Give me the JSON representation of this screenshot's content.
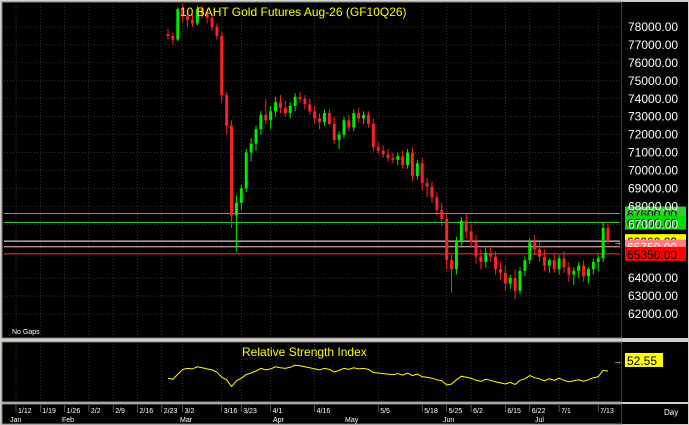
{
  "chart_data": {
    "type": "candlestick",
    "title": "10 BAHT  Gold  Futures  Aug-26  (GF10Q26)",
    "ylim": [
      61000,
      79500
    ],
    "yticks": [
      "78000.00",
      "77000.00",
      "76000.00",
      "75000.00",
      "74000.00",
      "73000.00",
      "72000.00",
      "71000.00",
      "70000.00",
      "69000.00",
      "68000.00",
      "67000.00",
      "64000.00",
      "63000.00",
      "62000.00"
    ],
    "note": "No Gaps",
    "levels": [
      {
        "label": "67600.00",
        "value": 67600,
        "color": "#33cc33",
        "bg": "#33cc33",
        "fg": "#000000"
      },
      {
        "label": "67100.00",
        "value": 67100,
        "color": "#33cc33",
        "bg": "#00dd00",
        "fg": "#000000"
      },
      {
        "label": "66060.00",
        "value": 66060,
        "color": "#ffffff",
        "bg": "#ffff00",
        "fg": "#000000"
      },
      {
        "label": "65750.00",
        "value": 65750,
        "color": "#ffbbbb",
        "bg": "#ff8080",
        "fg": "#ffffff"
      },
      {
        "label": "65350.00",
        "value": 65350,
        "color": "#ff3333",
        "bg": "#ff0000",
        "fg": "#000000"
      }
    ],
    "candles": [
      [
        77600,
        77900,
        77300,
        77500
      ],
      [
        77500,
        77700,
        77000,
        77300
      ],
      [
        77300,
        79100,
        77200,
        79000
      ],
      [
        79000,
        79300,
        78300,
        78600
      ],
      [
        78600,
        78900,
        78000,
        78400
      ],
      [
        78400,
        78700,
        78000,
        78200
      ],
      [
        78200,
        79200,
        78100,
        79000
      ],
      [
        79000,
        79200,
        78500,
        78700
      ],
      [
        78700,
        79000,
        78200,
        78500
      ],
      [
        78500,
        78700,
        77800,
        78000
      ],
      [
        78000,
        78200,
        77300,
        77500
      ],
      [
        77500,
        77700,
        73800,
        74200
      ],
      [
        74200,
        74400,
        72000,
        72500
      ],
      [
        72500,
        72800,
        66800,
        67500
      ],
      [
        67500,
        68600,
        65500,
        68200
      ],
      [
        68200,
        69200,
        67800,
        69000
      ],
      [
        69000,
        71200,
        68800,
        71000
      ],
      [
        71000,
        71800,
        70500,
        71500
      ],
      [
        71500,
        72500,
        71100,
        72300
      ],
      [
        72300,
        73300,
        72000,
        73100
      ],
      [
        73100,
        74000,
        72600,
        72800
      ],
      [
        72800,
        73600,
        72300,
        73300
      ],
      [
        73300,
        74100,
        73000,
        73800
      ],
      [
        73800,
        74200,
        73200,
        73500
      ],
      [
        73500,
        73900,
        73000,
        73200
      ],
      [
        73200,
        73800,
        72900,
        73600
      ],
      [
        73600,
        74300,
        73300,
        74100
      ],
      [
        74100,
        74400,
        73800,
        74000
      ],
      [
        74000,
        74200,
        73400,
        73700
      ],
      [
        73700,
        74000,
        73100,
        73300
      ],
      [
        73300,
        73600,
        72600,
        72900
      ],
      [
        72900,
        73200,
        72300,
        72700
      ],
      [
        72700,
        73400,
        72500,
        73200
      ],
      [
        73200,
        73400,
        72500,
        72600
      ],
      [
        72600,
        73000,
        71500,
        71700
      ],
      [
        71700,
        72200,
        71200,
        72000
      ],
      [
        72000,
        73000,
        71800,
        72800
      ],
      [
        72800,
        73100,
        72200,
        72400
      ],
      [
        72400,
        73400,
        72200,
        73200
      ],
      [
        73200,
        73500,
        72700,
        72900
      ],
      [
        72900,
        73300,
        72600,
        73100
      ],
      [
        73100,
        73300,
        72400,
        72600
      ],
      [
        72600,
        72900,
        71100,
        71300
      ],
      [
        71300,
        71600,
        70900,
        71100
      ],
      [
        71100,
        71400,
        70700,
        70900
      ],
      [
        70900,
        71200,
        70500,
        70700
      ],
      [
        70700,
        71000,
        70400,
        70600
      ],
      [
        70600,
        71000,
        70300,
        70800
      ],
      [
        70800,
        71100,
        70100,
        70300
      ],
      [
        70300,
        71200,
        70100,
        71000
      ],
      [
        71000,
        71300,
        69400,
        69700
      ],
      [
        69700,
        70600,
        69500,
        70400
      ],
      [
        70400,
        70700,
        68900,
        69300
      ],
      [
        69300,
        69600,
        68500,
        69100
      ],
      [
        69100,
        69400,
        68200,
        68500
      ],
      [
        68500,
        68800,
        67500,
        67800
      ],
      [
        67800,
        68200,
        66900,
        67300
      ],
      [
        67300,
        67600,
        64500,
        65000
      ],
      [
        65000,
        65300,
        63200,
        64500
      ],
      [
        64500,
        66300,
        64200,
        66000
      ],
      [
        66000,
        67400,
        65700,
        67200
      ],
      [
        67200,
        67600,
        66200,
        66600
      ],
      [
        66600,
        67000,
        65700,
        66000
      ],
      [
        66000,
        66400,
        64800,
        65200
      ],
      [
        65200,
        65600,
        64500,
        64900
      ],
      [
        64900,
        65700,
        64600,
        65400
      ],
      [
        65400,
        65800,
        64900,
        65200
      ],
      [
        65200,
        65500,
        64200,
        64500
      ],
      [
        64500,
        64900,
        63900,
        64300
      ],
      [
        64300,
        64700,
        63300,
        63700
      ],
      [
        63700,
        64200,
        63400,
        64000
      ],
      [
        64000,
        64500,
        62800,
        63300
      ],
      [
        63300,
        64600,
        63100,
        64400
      ],
      [
        64400,
        65200,
        64100,
        65000
      ],
      [
        65000,
        66200,
        64800,
        66000
      ],
      [
        66000,
        66400,
        65300,
        65600
      ],
      [
        65600,
        66000,
        64900,
        65200
      ],
      [
        65200,
        65600,
        64400,
        64700
      ],
      [
        64700,
        65100,
        64300,
        65000
      ],
      [
        65000,
        65400,
        64300,
        64500
      ],
      [
        64500,
        65300,
        64200,
        65100
      ],
      [
        65100,
        65500,
        64300,
        64600
      ],
      [
        64600,
        64900,
        63800,
        64200
      ],
      [
        64200,
        64600,
        63600,
        64400
      ],
      [
        64400,
        64900,
        64000,
        64700
      ],
      [
        64700,
        65000,
        63800,
        64100
      ],
      [
        64100,
        64600,
        63700,
        64500
      ],
      [
        64500,
        65100,
        64200,
        64900
      ],
      [
        64900,
        65300,
        64400,
        65100
      ],
      [
        65100,
        67100,
        64900,
        66800
      ],
      [
        66800,
        67000,
        65900,
        66060
      ]
    ],
    "rsi": {
      "label": "Relative Strength Index",
      "current": "52.55",
      "ylim": [
        0,
        100
      ],
      "values": [
        38,
        36,
        46,
        55,
        57,
        56,
        60,
        58,
        56,
        54,
        50,
        40,
        35,
        22,
        33,
        38,
        45,
        48,
        52,
        57,
        54,
        56,
        60,
        58,
        57,
        59,
        63,
        62,
        60,
        58,
        56,
        54,
        57,
        55,
        50,
        53,
        57,
        55,
        58,
        56,
        57,
        55,
        49,
        48,
        47,
        46,
        45,
        47,
        44,
        48,
        43,
        46,
        41,
        40,
        38,
        35,
        33,
        25,
        27,
        35,
        42,
        40,
        38,
        34,
        32,
        36,
        34,
        31,
        29,
        27,
        30,
        26,
        34,
        37,
        43,
        39,
        37,
        33,
        37,
        34,
        38,
        34,
        31,
        33,
        35,
        32,
        35,
        39,
        41,
        53,
        52
      ]
    },
    "x_ticks": [
      {
        "label": "1/12",
        "i": 0
      },
      {
        "label": "1/19",
        "i": 0
      },
      {
        "label": "1/26",
        "i": 0
      },
      {
        "label": "2/2",
        "i": 0
      },
      {
        "label": "2/9",
        "i": 0
      },
      {
        "label": "2/16",
        "i": 0
      },
      {
        "label": "2/23",
        "i": 0
      },
      {
        "label": "3/2",
        "i": 3
      },
      {
        "label": "3/16",
        "i": 11
      },
      {
        "label": "3/23",
        "i": 15
      },
      {
        "label": "4/1",
        "i": 21
      },
      {
        "label": "4/16",
        "i": 30
      },
      {
        "label": "5/5",
        "i": 43
      },
      {
        "label": "5/18",
        "i": 52
      },
      {
        "label": "5/25",
        "i": 57
      },
      {
        "label": "6/2",
        "i": 62
      },
      {
        "label": "6/15",
        "i": 69
      },
      {
        "label": "6/22",
        "i": 74
      },
      {
        "label": "7/1",
        "i": 80
      },
      {
        "label": "7/13",
        "i": 88
      }
    ],
    "month_labels": [
      "Jan",
      "Feb",
      "Mar",
      "Apr",
      "May",
      "Jun",
      "Jul"
    ],
    "x_unit": "Day"
  }
}
